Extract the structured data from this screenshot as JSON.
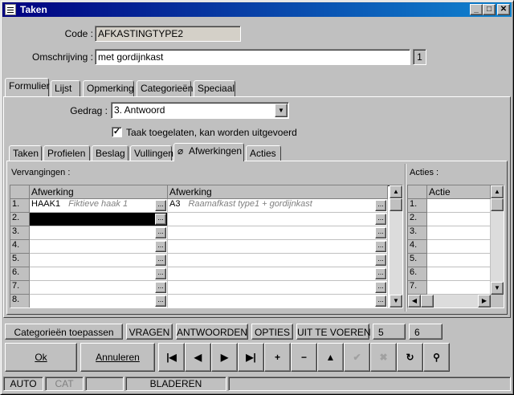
{
  "window": {
    "title": "Taken",
    "minimize": "_",
    "maximize": "□",
    "close": "✕"
  },
  "form": {
    "code_label": "Code :",
    "code_value": "AFKASTINGTYPE2",
    "omschrijving_label": "Omschrijving :",
    "omschrijving_value": "met gordijnkast",
    "omschrijving_count": "1"
  },
  "tabs": [
    {
      "label": "Formulier"
    },
    {
      "label": "Lijst"
    },
    {
      "label": "Opmerking"
    },
    {
      "label": "Categorieën"
    },
    {
      "label": "Speciaal"
    }
  ],
  "gedrag": {
    "label": "Gedrag :",
    "value": "3.  Antwoord"
  },
  "checkbox": {
    "label": "Taak toegelaten, kan worden uitgevoerd",
    "checked": true
  },
  "subtabs": [
    {
      "label": "Taken"
    },
    {
      "label": "Profielen"
    },
    {
      "label": "Beslag"
    },
    {
      "label": "Vullingen"
    },
    {
      "label": "Afwerkingen",
      "icon": "paperclip-icon"
    },
    {
      "label": "Acties"
    }
  ],
  "vervangingen": {
    "title": "Vervangingen :",
    "headers": [
      "Afwerking",
      "Afwerking"
    ],
    "rows": [
      {
        "n": "1.",
        "code1": "HAAK1",
        "desc1": "Fiktieve haak 1",
        "code2": "A3",
        "desc2": "Raamafkast type1 + gordijnkast"
      },
      {
        "n": "2.",
        "code1": "",
        "desc1": "",
        "code2": "",
        "desc2": ""
      },
      {
        "n": "3.",
        "code1": "",
        "desc1": "",
        "code2": "",
        "desc2": ""
      },
      {
        "n": "4.",
        "code1": "",
        "desc1": "",
        "code2": "",
        "desc2": ""
      },
      {
        "n": "5.",
        "code1": "",
        "desc1": "",
        "code2": "",
        "desc2": ""
      },
      {
        "n": "6.",
        "code1": "",
        "desc1": "",
        "code2": "",
        "desc2": ""
      },
      {
        "n": "7.",
        "code1": "",
        "desc1": "",
        "code2": "",
        "desc2": ""
      },
      {
        "n": "8.",
        "code1": "",
        "desc1": "",
        "code2": "",
        "desc2": ""
      }
    ],
    "selected_row": 2
  },
  "acties": {
    "title": "Acties :",
    "header": "Actie",
    "rows": [
      "1.",
      "2.",
      "3.",
      "4.",
      "5.",
      "6.",
      "7."
    ]
  },
  "buttonbar": [
    "Categorieën toepassen",
    "VRAGEN",
    "ANTWOORDEN",
    "OPTIES",
    "UIT TE VOEREN",
    "5",
    "6"
  ],
  "actions": {
    "ok": "Ok",
    "annuleren": "Annuleren"
  },
  "nav_icons": [
    "first-record-icon",
    "prev-record-icon",
    "next-record-icon",
    "last-record-icon",
    "add-icon",
    "delete-icon",
    "up-icon",
    "confirm-icon",
    "cancel-icon",
    "refresh-icon",
    "find-icon"
  ],
  "nav_glyphs": [
    "|◀",
    "◀",
    "▶",
    "▶|",
    "+",
    "−",
    "▲",
    "✔",
    "✖",
    "↻",
    "⚲"
  ],
  "status": [
    "AUTO",
    "CAT",
    "",
    "BLADEREN",
    ""
  ]
}
